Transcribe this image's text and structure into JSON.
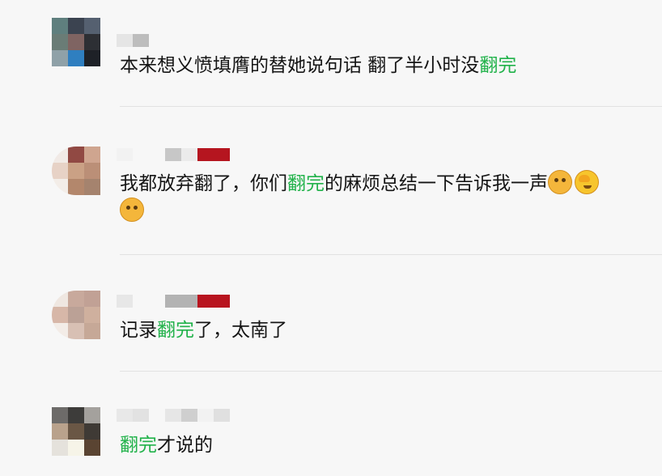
{
  "comments": [
    {
      "text_segments": [
        {
          "text": "本来想义愤填膺的替她说句话  翻了半小时没",
          "highlight": false
        },
        {
          "text": "翻完",
          "highlight": true
        }
      ]
    },
    {
      "text_segments": [
        {
          "text": "我都放弃翻了，你们",
          "highlight": false
        },
        {
          "text": "翻完",
          "highlight": true
        },
        {
          "text": "的麻烦总结一下告诉我一声",
          "highlight": false
        }
      ],
      "emojis": [
        "doge-emoji",
        "facepalm-emoji",
        "doge-emoji"
      ]
    },
    {
      "text_segments": [
        {
          "text": "记录",
          "highlight": false
        },
        {
          "text": "翻完",
          "highlight": true
        },
        {
          "text": "了，太南了",
          "highlight": false
        }
      ]
    },
    {
      "text_segments": [
        {
          "text": "翻完",
          "highlight": true
        },
        {
          "text": "才说的",
          "highlight": false
        }
      ]
    }
  ],
  "colors": {
    "highlight": "#21b24a",
    "text": "#151515",
    "background": "#f7f7f7",
    "divider": "#e2e2e2"
  }
}
